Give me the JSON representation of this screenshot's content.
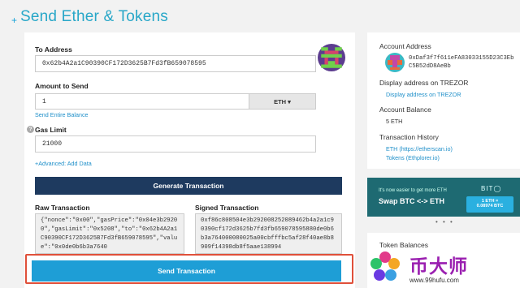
{
  "header": {
    "plus": "+",
    "title": "Send Ether & Tokens"
  },
  "form": {
    "to_label": "To Address",
    "to_value": "0x62b4A2a1C90390CF172D3625B7Fd3fB659078595",
    "amount_label": "Amount to Send",
    "amount_value": "1",
    "unit": "ETH ▾",
    "send_entire": "Send Entire Balance",
    "gas_label": "Gas Limit",
    "gas_help": "?",
    "gas_value": "21000",
    "advanced": "+Advanced: Add Data",
    "generate_button": "Generate Transaction",
    "raw_label": "Raw Transaction",
    "raw_value": "{\"nonce\":\"0x00\",\"gasPrice\":\"0x04e3b29200\",\"gasLimit\":\"0x5208\",\"to\":\"0x62b4A2a1C90390CF172D3625B7Fd3fB659078595\",\"value\":\"0x0de0b6b3a7640",
    "signed_label": "Signed Transaction",
    "signed_value": "0xf86c808504e3b292008252089462b4a2a1c90390cf172d3625b7fd3fb659078595880de0b6b3a764000080025a00cbfffbc5af28f40ae8b8909f14398db8f5aae138994",
    "send_button": "Send Transaction"
  },
  "sidebar": {
    "account_address_label": "Account Address",
    "account_address": "0xDaf3f7f611eFA83033155D23C3EbC5B52dD8AeBb",
    "display_label": "Display address on TREZOR",
    "display_link": "Display address on TREZOR",
    "balance_label": "Account Balance",
    "balance_value": "5 ETH",
    "history_label": "Transaction History",
    "history_eth": "ETH (https://etherscan.io)",
    "history_tokens": "Tokens (Ethplorer.io)"
  },
  "banner": {
    "line1": "It's now easier to get more ETH",
    "line2": "Swap BTC <-> ETH",
    "brand": "BIT◯",
    "rate1": "1 ETH =",
    "rate2": "0.08974 BTC"
  },
  "dots": "• • •",
  "token": {
    "label": "Token Balances"
  },
  "watermark": {
    "name": "币大师",
    "url": "www.99hufu.com"
  },
  "colors": {
    "accent": "#1e9ed6",
    "navy": "#1e3a5f",
    "highlight": "#e0503a",
    "teal": "#1e6a72"
  }
}
